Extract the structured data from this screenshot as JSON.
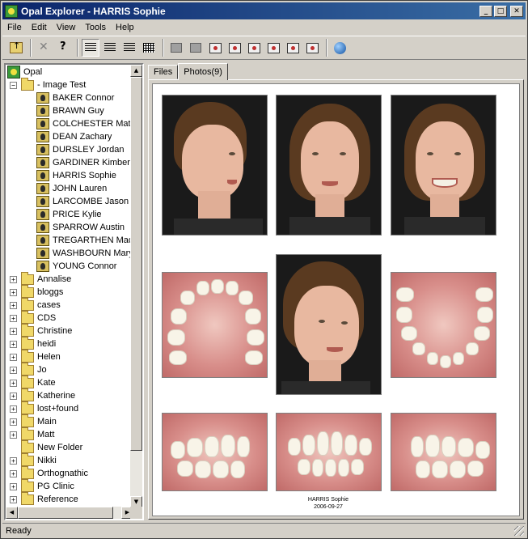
{
  "window": {
    "title": "Opal Explorer - HARRIS Sophie"
  },
  "menu": {
    "items": [
      "File",
      "Edit",
      "View",
      "Tools",
      "Help"
    ]
  },
  "toolbar": {
    "buttons": [
      "up-folder-icon",
      "delete-icon",
      "whats-this-help-icon",
      "large-icons-view-icon",
      "small-icons-view-icon",
      "list-view-icon",
      "details-view-icon",
      "capture-icon",
      "camera-icon",
      "camera-add-icon",
      "camera-settings-icon",
      "photo-frame-icon",
      "photo-edit-icon",
      "photo-grid-icon",
      "photo-export-icon",
      "search-globe-icon"
    ]
  },
  "tree": {
    "root": "Opal",
    "open_folder": "- Image Test",
    "patients": [
      "BAKER Connor",
      "BRAWN Guy",
      "COLCHESTER Matth",
      "DEAN Zachary",
      "DURSLEY Jordan",
      "GARDINER Kimberly",
      "HARRIS Sophie",
      "JOHN Lauren",
      "LARCOMBE Jason",
      "PRICE Kylie",
      "SPARROW Austin",
      "TREGARTHEN Madis",
      "WASHBOURN Mary",
      "YOUNG Connor"
    ],
    "folders": [
      "Annalise",
      "bloggs",
      "cases",
      "CDS",
      "Christine",
      "heidi",
      "Helen",
      "Jo",
      "Kate",
      "Katherine",
      "lost+found",
      "Main",
      "Matt",
      "New Folder",
      "Nikki",
      "Orthognathic",
      "PG Clinic",
      "Reference"
    ]
  },
  "tabs": {
    "files": "Files",
    "photos": "Photos(9)"
  },
  "sheet": {
    "caption_name": "HARRIS Sophie",
    "caption_date": "2006-09-27"
  },
  "status": {
    "text": "Ready"
  }
}
